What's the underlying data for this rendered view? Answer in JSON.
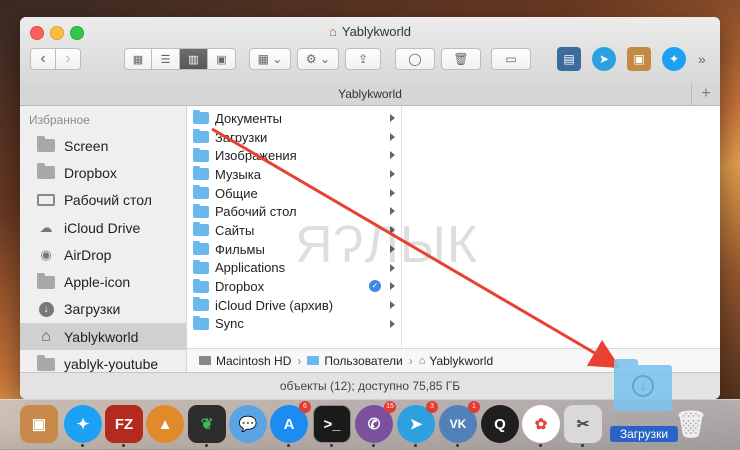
{
  "window": {
    "title": "Yablykworld",
    "tab_title": "Yablykworld",
    "tab_add": "+"
  },
  "toolbar": {
    "back": "‹",
    "forward": "›",
    "view_icons": "▦",
    "view_list": "☰",
    "view_columns": "▥",
    "view_gallery": "▣",
    "group": "▦ ⌄",
    "action": "⚙ ⌄",
    "more": "»"
  },
  "sidebar": {
    "heading": "Избранное",
    "items": [
      {
        "label": "Screen",
        "icon": "folder-icon"
      },
      {
        "label": "Dropbox",
        "icon": "folder-icon"
      },
      {
        "label": "Рабочий стол",
        "icon": "desktop-icon"
      },
      {
        "label": "iCloud Drive",
        "icon": "cloud-icon"
      },
      {
        "label": "AirDrop",
        "icon": "airdrop-icon"
      },
      {
        "label": "Apple-icon",
        "icon": "folder-icon"
      },
      {
        "label": "Загрузки",
        "icon": "download-icon"
      },
      {
        "label": "Yablykworld",
        "icon": "home-icon",
        "selected": true
      },
      {
        "label": "yablyk-youtube",
        "icon": "folder-icon"
      }
    ]
  },
  "column": {
    "items": [
      "Документы",
      "Загрузки",
      "Изображения",
      "Музыка",
      "Общие",
      "Рабочий стол",
      "Сайты",
      "Фильмы",
      "Applications",
      "Dropbox",
      "iCloud Drive (архив)",
      "Sync"
    ]
  },
  "pathbar": {
    "segments": [
      "Macintosh HD",
      "Пользователи",
      "Yablykworld"
    ],
    "separator": "›"
  },
  "status": "объекты (12); доступно 75,85 ГБ",
  "watermark": "ЯɁЛЫК",
  "drag": {
    "label": "Загрузки"
  },
  "dock": {
    "badges": {
      "appstore": "6",
      "viber": "15",
      "telegram": "3",
      "vk": "1"
    },
    "vk_label": "VK",
    "filezilla_label": "FZ"
  },
  "colors": {
    "arrow": "#e8412f",
    "selection": "#2a63c7",
    "folder_blue": "#6ab9ec"
  }
}
